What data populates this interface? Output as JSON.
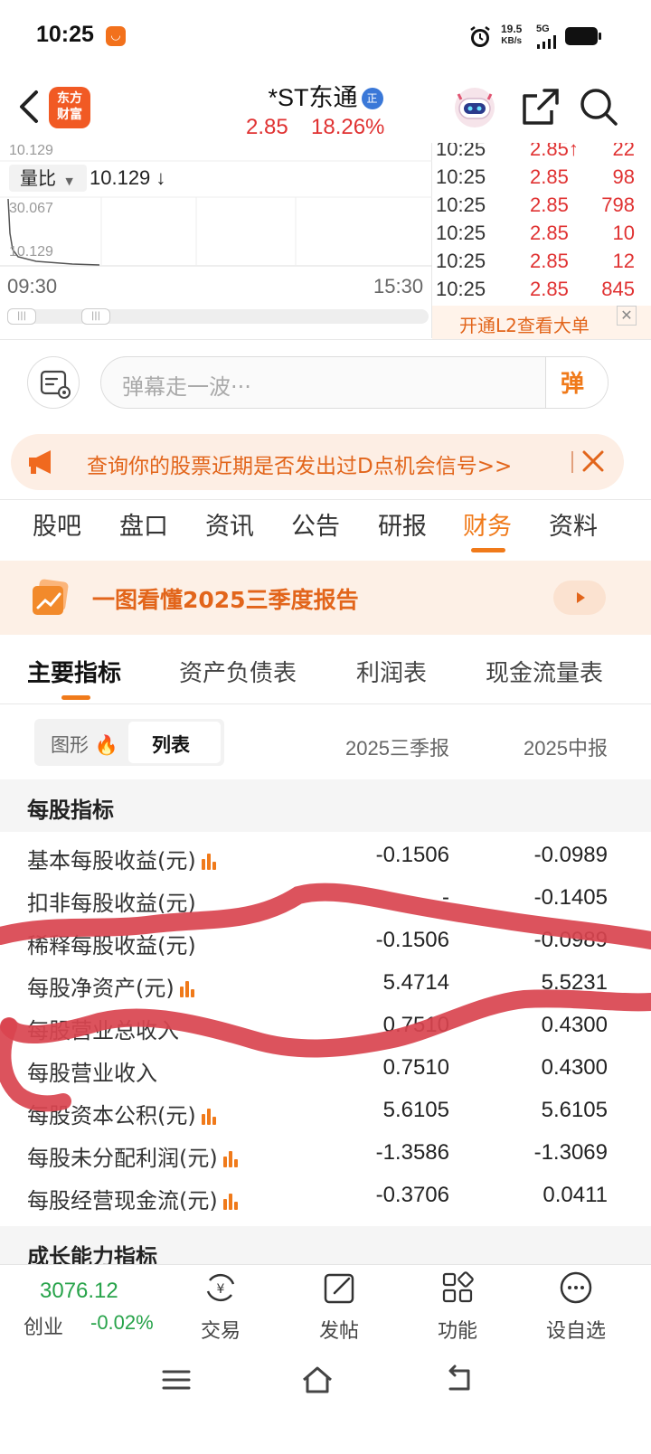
{
  "status_bar": {
    "time": "10:25",
    "notif_badge": "◡",
    "net_speed_value": "19.5",
    "net_speed_unit": "KB/s",
    "net_type": "5G"
  },
  "header": {
    "logo_text_line1": "东方",
    "logo_text_line2": "财富",
    "stock_name": "*ST东通",
    "verified_badge": "正",
    "price": "2.85",
    "change_pct": "18.26%"
  },
  "chart": {
    "top_label": "10.129",
    "volratio_label": "量比",
    "volratio_value": "10.129 ↓",
    "y_max_label": "30.067",
    "y_min_label": "10.129",
    "time_start": "09:30",
    "time_end": "15:30"
  },
  "ticks": [
    {
      "time": "10:25",
      "price": "2.85↑",
      "vol": "22"
    },
    {
      "time": "10:25",
      "price": "2.85",
      "vol": "98"
    },
    {
      "time": "10:25",
      "price": "2.85",
      "vol": "798"
    },
    {
      "time": "10:25",
      "price": "2.85",
      "vol": "10"
    },
    {
      "time": "10:25",
      "price": "2.85",
      "vol": "12"
    },
    {
      "time": "10:25",
      "price": "2.85",
      "vol": "845"
    }
  ],
  "l2_banner": {
    "text": "开通L2查看大单",
    "close": "✕"
  },
  "danmaku": {
    "placeholder": "弹幕走一波···",
    "send_label": "弹"
  },
  "promo": {
    "text": "查询你的股票近期是否发出过D点机会信号>>"
  },
  "main_tabs": [
    "股吧",
    "盘口",
    "资讯",
    "公告",
    "研报",
    "财务",
    "资料"
  ],
  "report_banner": {
    "text": "一图看懂2025三季度报告"
  },
  "sub_tabs": [
    "主要指标",
    "资产负债表",
    "利润表",
    "现金流量表"
  ],
  "view_toggle": {
    "chart_label": "图形",
    "list_label": "列表"
  },
  "columns": [
    "2025三季报",
    "2025中报"
  ],
  "sections": {
    "per_share": "每股指标",
    "growth": "成长能力指标"
  },
  "rows": [
    {
      "label": "基本每股收益(元)",
      "v1": "-0.1506",
      "v2": "-0.0989"
    },
    {
      "label": "扣非每股收益(元)",
      "v1": "-",
      "v2": "-0.1405"
    },
    {
      "label": "稀释每股收益(元)",
      "v1": "-0.1506",
      "v2": "-0.0989"
    },
    {
      "label": "每股净资产(元)",
      "v1": "5.4714",
      "v2": "5.5231"
    },
    {
      "label": "每股营业总收入",
      "v1": "0.7510",
      "v2": "0.4300"
    },
    {
      "label": "每股营业收入",
      "v1": "0.7510",
      "v2": "0.4300"
    },
    {
      "label": "每股资本公积(元)",
      "v1": "5.6105",
      "v2": "5.6105"
    },
    {
      "label": "每股未分配利润(元)",
      "v1": "-1.3586",
      "v2": "-1.3069"
    },
    {
      "label": "每股经营现金流(元)",
      "v1": "-0.3706",
      "v2": "0.0411"
    }
  ],
  "bottom_nav": {
    "index_value": "3076.12",
    "index_name": "创业",
    "index_change": "-0.02%",
    "items": [
      "交易",
      "发帖",
      "功能",
      "设自选"
    ]
  },
  "colors": {
    "accent": "#f07a1a",
    "up": "#e03232",
    "down": "#27a34a",
    "scribble": "#d9444f"
  }
}
